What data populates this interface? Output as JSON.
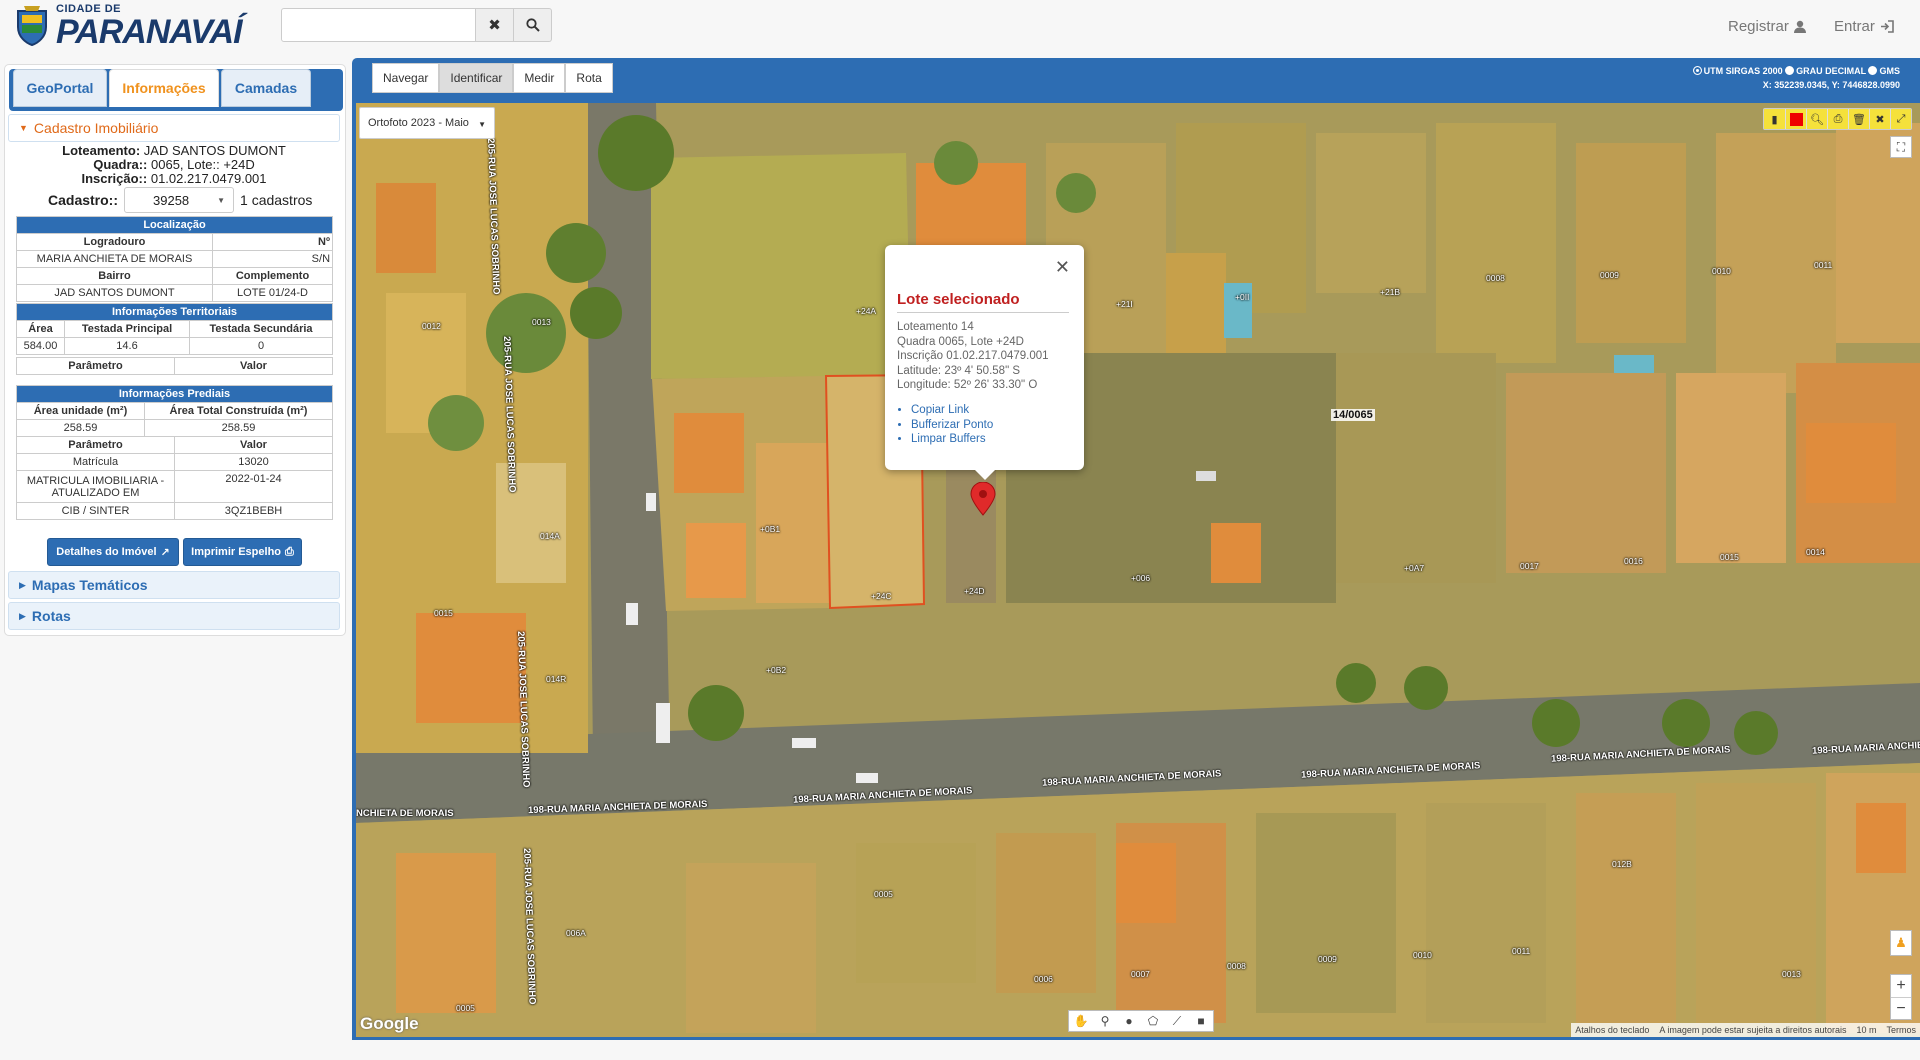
{
  "header": {
    "logo_small": "CIDADE DE",
    "logo_big": "PARANAVAÍ",
    "search_value": "",
    "register_label": "Registrar",
    "login_label": "Entrar"
  },
  "panel": {
    "tabs": [
      {
        "label": "GeoPortal"
      },
      {
        "label": "Informações"
      },
      {
        "label": "Camadas"
      }
    ],
    "section_open": "Cadastro Imobiliário",
    "loteamento_label": "Loteamento:",
    "loteamento_value": "JAD SANTOS DUMONT",
    "quadra_label": "Quadra::",
    "quadra_value": "0065, Lote::",
    "lote_value": "+24D",
    "inscricao_label": "Inscrição::",
    "inscricao_value": "01.02.217.0479.001",
    "cadastro_label": "Cadastro::",
    "cadastro_selected": "39258",
    "cadastro_count": "1 cadastros",
    "localizacao": {
      "title": "Localização",
      "col1": "Logradouro",
      "col2": "Nº",
      "logradouro": "MARIA ANCHIETA DE MORAIS",
      "numero": "S/N",
      "col3": "Bairro",
      "col4": "Complemento",
      "bairro": "JAD SANTOS DUMONT",
      "complemento": "LOTE 01/24-D"
    },
    "territoriais": {
      "title": "Informações Territoriais",
      "h_area": "Área",
      "h_tp": "Testada Principal",
      "h_ts": "Testada Secundária",
      "area": "584.00",
      "tp": "14.6",
      "ts": "0",
      "h_param": "Parâmetro",
      "h_valor": "Valor"
    },
    "prediais": {
      "title": "Informações Prediais",
      "h_au": "Área unidade (m²)",
      "h_atc": "Área Total Construída (m²)",
      "au": "258.59",
      "atc": "258.59",
      "h_param": "Parâmetro",
      "h_valor": "Valor",
      "rows": [
        {
          "param": "Matrícula",
          "valor": "13020"
        },
        {
          "param": "MATRICULA IMOBILIARIA - ATUALIZADO EM",
          "valor": "2022-01-24"
        },
        {
          "param": "CIB / SINTER",
          "valor": "3QZ1BEBH"
        }
      ]
    },
    "btn_detalhes": "Detalhes do Imóvel",
    "btn_imprimir": "Imprimir Espelho",
    "section_mapas": "Mapas Temáticos",
    "section_rotas": "Rotas"
  },
  "map": {
    "modes": [
      {
        "label": "Navegar"
      },
      {
        "label": "Identificar"
      },
      {
        "label": "Medir"
      },
      {
        "label": "Rota"
      }
    ],
    "coord_opts": [
      "UTM SIRGAS 2000",
      "GRAU DECIMAL",
      "GMS"
    ],
    "coord_readout": "X: 352239.0345, Y: 7446828.0990",
    "layer_selected": "Ortofoto 2023 - Maio",
    "popup": {
      "title": "Lote selecionado",
      "lines": [
        "Loteamento 14",
        "Quadra 0065, Lote +24D",
        "Inscrição 01.02.217.0479.001",
        "Latitude: 23º 4' 50.58\" S",
        "Longitude: 52º 26' 33.30\" O"
      ],
      "links": [
        "Copiar Link",
        "Bufferizar Ponto",
        "Limpar Buffers"
      ]
    },
    "quadra_label": "14/0065",
    "streets": [
      "205-RUA JOSE LUCAS SOBRINHO",
      "205-RUA JOSE LUCAS SOBRINHO",
      "205-RUA JOSE LUCAS SOBRINHO",
      "205-RUA JOSE LUCAS SOBRINHO",
      "198-RUA MARIA ANCHIETA DE MORAIS",
      "198-RUA MARIA ANCHIETA DE MORAIS",
      "198-RUA MARIA ANCHIETA DE MORAIS",
      "198-RUA MARIA ANCHIETA DE MORAIS",
      "198-RUA MARIA ANCHIETA DE MORAIS",
      "198-RUA MARIA ANCHIETA DE MORAIS",
      "NCHIETA DE MORAIS"
    ],
    "lots": [
      "+24A",
      "+21I",
      "+0II",
      "+21B",
      "0008",
      "0009",
      "0010",
      "0011",
      "0012",
      "0013",
      "014A",
      "0015",
      "014R",
      "+0B1",
      "+0B2",
      "+24C",
      "+24D",
      "+006",
      "+0A7",
      "0017",
      "0016",
      "0015",
      "0014",
      "0005",
      "006A",
      "0005",
      "0006",
      "0007",
      "0008",
      "0009",
      "0010",
      "0011",
      "012B",
      "0013"
    ],
    "google": "Google",
    "attrib": [
      "Atalhos do teclado",
      "A imagem pode estar sujeita a direitos autorais",
      "10 m",
      "Termos"
    ],
    "colors": {
      "accent": "#2d6db3",
      "popup_title": "#c02020",
      "tab_active": "#f0921e"
    }
  }
}
